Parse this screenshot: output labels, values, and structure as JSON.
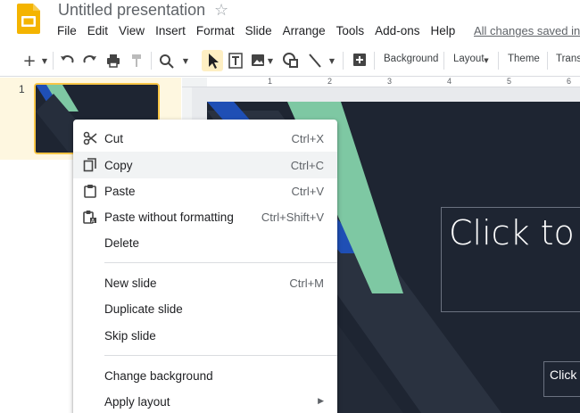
{
  "app": {
    "title": "Untitled presentation",
    "saved_status": "All changes saved in"
  },
  "menubar": [
    "File",
    "Edit",
    "View",
    "Insert",
    "Format",
    "Slide",
    "Arrange",
    "Tools",
    "Add-ons",
    "Help"
  ],
  "toolbar": {
    "background_label": "Background",
    "layout_label": "Layout",
    "theme_label": "Theme",
    "transition_label": "Trans"
  },
  "filmstrip": {
    "slide_number": "1"
  },
  "ruler": {
    "marks": [
      "1",
      "2",
      "3",
      "4",
      "5",
      "6"
    ]
  },
  "slide": {
    "title_placeholder": "Click to",
    "subtitle_placeholder": "Click to"
  },
  "context_menu": {
    "items": [
      {
        "label": "Cut",
        "shortcut": "Ctrl+X",
        "icon": "scissors-icon"
      },
      {
        "label": "Copy",
        "shortcut": "Ctrl+C",
        "icon": "copy-icon"
      },
      {
        "label": "Paste",
        "shortcut": "Ctrl+V",
        "icon": "clipboard-icon"
      },
      {
        "label": "Paste without formatting",
        "shortcut": "Ctrl+Shift+V",
        "icon": "paste-plain-icon"
      },
      {
        "label": "Delete",
        "shortcut": ""
      },
      {
        "label": "New slide",
        "shortcut": "Ctrl+M"
      },
      {
        "label": "Duplicate slide",
        "shortcut": ""
      },
      {
        "label": "Skip slide",
        "shortcut": ""
      },
      {
        "label": "Change background",
        "shortcut": ""
      },
      {
        "label": "Apply layout",
        "shortcut": ""
      }
    ],
    "highlighted": "Copy"
  },
  "colors": {
    "slide_bg": "#1e2532",
    "accent_green": "#7ec8a3",
    "accent_blue": "#1f4fb5",
    "selection_yellow": "#f9c646",
    "logo_yellow": "#f4b400"
  }
}
